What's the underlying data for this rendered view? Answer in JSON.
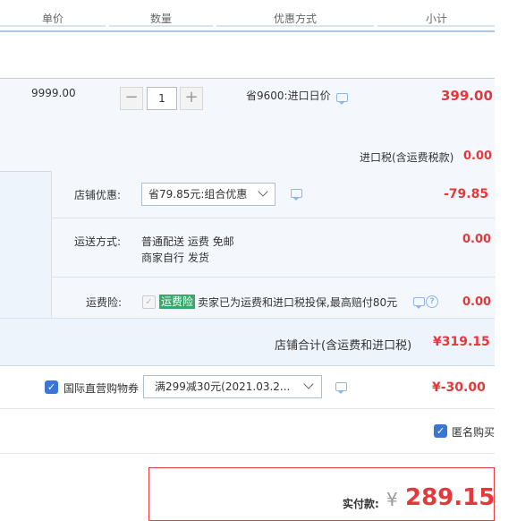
{
  "header": {
    "col_price": "单价",
    "col_qty": "数量",
    "col_discount": "优惠方式",
    "col_subtotal": "小计"
  },
  "item": {
    "unit_price": "9999.00",
    "qty_minus": "−",
    "qty_value": "1",
    "qty_plus": "+",
    "promo": "省9600:进口日价",
    "subtotal": "399.00",
    "import_tax_label": "进口税(含运费税款)",
    "import_tax_value": "0.00"
  },
  "shop": {
    "discount_label": "店铺优惠:",
    "discount_select": "省79.85元:组合优惠",
    "discount_value": "-79.85",
    "shipping_label": "运送方式:",
    "shipping_line1": "普通配送 运费 免邮",
    "shipping_line2": "商家自行  发货",
    "shipping_value": "0.00",
    "insurance_label": "运费险:",
    "insurance_badge": "运费险",
    "insurance_text": "卖家已为运费和进口税投保,最高赔付80元",
    "insurance_value": "0.00",
    "shop_total_label": "店铺合计(含运费和进口税)",
    "shop_total_value": "¥319.15"
  },
  "coupon": {
    "label": "国际直营购物券",
    "select": "满299减30元(2021.03.2...",
    "value": "¥-30.00"
  },
  "anonymous": {
    "label": "匿名购买"
  },
  "payment": {
    "label": "实付款:",
    "currency": "¥",
    "amount": "289.15"
  },
  "colors": {
    "accent_red": "#e4393c",
    "checkbox_blue": "#3a76d3",
    "badge_green": "#3aa76d"
  }
}
